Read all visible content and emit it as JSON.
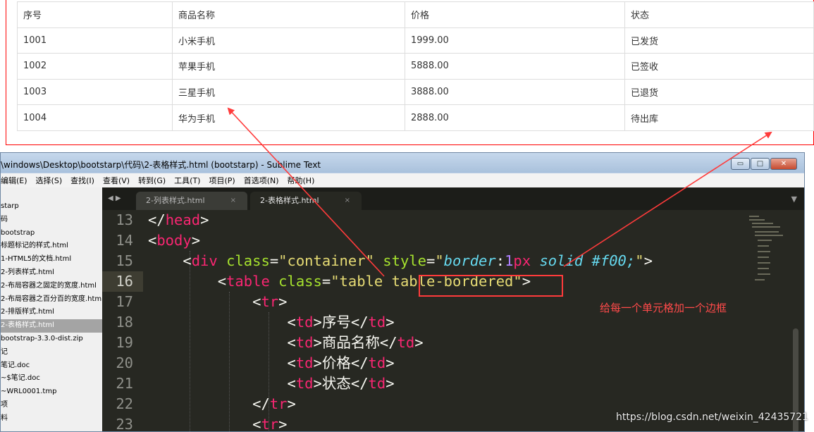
{
  "rendered_table": {
    "rows": [
      [
        "序号",
        "商品名称",
        "价格",
        "状态"
      ],
      [
        "1001",
        "小米手机",
        "1999.00",
        "已发货"
      ],
      [
        "1002",
        "苹果手机",
        "5888.00",
        "已签收"
      ],
      [
        "1003",
        "三星手机",
        "3888.00",
        "已退货"
      ],
      [
        "1004",
        "华为手机",
        "2888.00",
        "待出库"
      ]
    ]
  },
  "window": {
    "title": "\\windows\\Desktop\\bootstarp\\代码\\2-表格样式.html (bootstarp) - Sublime Text",
    "controls": {
      "minimize": "▭",
      "maximize": "□",
      "close": "✕"
    }
  },
  "menu": {
    "items": [
      "编辑(E)",
      "选择(S)",
      "查找(I)",
      "查看(V)",
      "转到(G)",
      "工具(T)",
      "项目(P)",
      "首选项(N)",
      "帮助(H)"
    ]
  },
  "sidebar": {
    "items": [
      "starp",
      "码",
      "bootstrap",
      "标题标记的样式.html",
      "1-HTML5的文档.html",
      "2-列表样式.html",
      "2-布局容器之固定的宽度.html",
      "2-布局容器之百分百的宽度.html",
      "2-排版样式.html",
      "2-表格样式.html",
      "bootstrap-3.3.0-dist.zip",
      "记",
      "笔记.doc",
      "~$笔记.doc",
      "~WRL0001.tmp",
      "项",
      "料"
    ],
    "active_index": 9
  },
  "tabs": {
    "nav": "◀ ▶",
    "items": [
      {
        "label": "2-列表样式.html",
        "close": "×"
      },
      {
        "label": "2-表格样式.html",
        "close": "×"
      }
    ],
    "dropdown": "▼"
  },
  "code": {
    "current_line": "16",
    "lines": [
      {
        "n": "13",
        "p": [
          "</",
          "head",
          ">"
        ]
      },
      {
        "n": "14",
        "p": [
          "<",
          "body",
          ">"
        ]
      },
      {
        "n": "15",
        "p": [
          "    <",
          "div",
          " ",
          "class",
          "=",
          "\"container\"",
          " ",
          "style",
          "=",
          "\"",
          "border",
          ":",
          "1",
          "px",
          " solid #f00;",
          "\"",
          ">"
        ]
      },
      {
        "n": "16",
        "p": [
          "        <",
          "table",
          " ",
          "class",
          "=",
          "\"table table-bordered\"",
          ">"
        ]
      },
      {
        "n": "17",
        "p": [
          "            <",
          "tr",
          ">"
        ]
      },
      {
        "n": "18",
        "p": [
          "                <",
          "td",
          ">",
          "序号",
          "</",
          "td",
          ">"
        ]
      },
      {
        "n": "19",
        "p": [
          "                <",
          "td",
          ">",
          "商品名称",
          "</",
          "td",
          ">"
        ]
      },
      {
        "n": "20",
        "p": [
          "                <",
          "td",
          ">",
          "价格",
          "</",
          "td",
          ">"
        ]
      },
      {
        "n": "21",
        "p": [
          "                <",
          "td",
          ">",
          "状态",
          "</",
          "td",
          ">"
        ]
      },
      {
        "n": "22",
        "p": [
          "            </",
          "tr",
          ">"
        ]
      },
      {
        "n": "23",
        "p": [
          "            <",
          "tr",
          ">"
        ]
      }
    ]
  },
  "annotation": "给每一个单元格加一个边框",
  "watermark": "https://blog.csdn.net/weixin_42435721",
  "colors": {
    "annotation_red": "#ff3b3b",
    "editor_bg": "#272822",
    "tag": "#f92672",
    "attr": "#a6e22e",
    "string": "#e6db74",
    "keyword": "#66d9ef",
    "number": "#ae81ff"
  }
}
